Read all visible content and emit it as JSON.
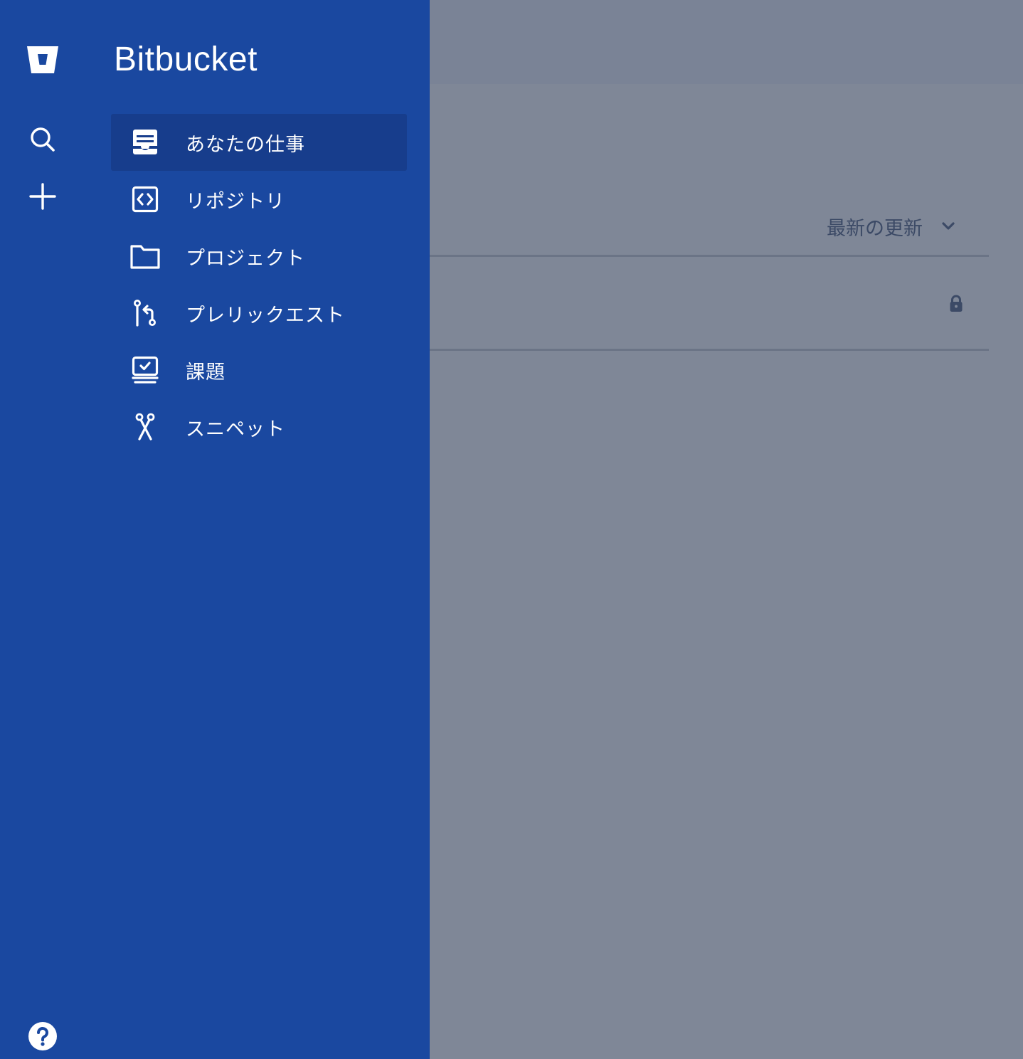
{
  "background": {
    "sort_label": "最新の更新",
    "sort_icon": "chevron-down-icon",
    "private_icon": "lock-icon"
  },
  "sidebar": {
    "product_name": "Bitbucket",
    "global_items": [
      {
        "name": "bitbucket-logo",
        "icon": "bitbucket-logo"
      },
      {
        "name": "search",
        "icon": "search-icon"
      },
      {
        "name": "create",
        "icon": "plus-icon"
      },
      {
        "name": "help",
        "icon": "question-icon"
      }
    ],
    "items": [
      {
        "label": "あなたの仕事",
        "icon": "your-work-icon",
        "active": true
      },
      {
        "label": "リポジトリ",
        "icon": "code-icon",
        "active": false
      },
      {
        "label": "プロジェクト",
        "icon": "folder-icon",
        "active": false
      },
      {
        "label": "プレリックエスト",
        "icon": "pull-request-icon",
        "active": false
      },
      {
        "label": "課題",
        "icon": "issues-icon",
        "active": false
      },
      {
        "label": "スニペット",
        "icon": "snippets-icon",
        "active": false
      }
    ]
  },
  "colors": {
    "sidebar_bg": "#1a48a0",
    "active_item_bg": "#173d8c",
    "overlay_bg": "#7f8797"
  }
}
